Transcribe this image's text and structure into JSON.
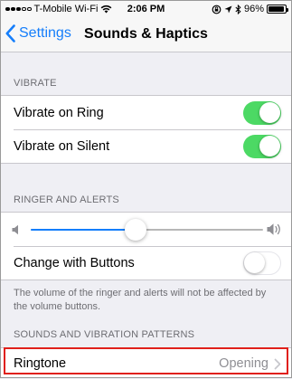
{
  "status_bar": {
    "carrier": "T-Mobile Wi-Fi",
    "time": "2:06 PM",
    "battery": "96%",
    "battery_level": 0.96
  },
  "nav": {
    "back_label": "Settings",
    "title": "Sounds & Haptics"
  },
  "vibrate": {
    "header": "VIBRATE",
    "items": [
      {
        "label": "Vibrate on Ring",
        "on": true
      },
      {
        "label": "Vibrate on Silent",
        "on": true
      }
    ]
  },
  "ringer": {
    "header": "RINGER AND ALERTS",
    "volume_level": 0.45,
    "change_with_buttons_label": "Change with Buttons",
    "change_with_buttons_on": false,
    "footer": "The volume of the ringer and alerts will not be affected by the volume buttons."
  },
  "patterns": {
    "header": "SOUNDS AND VIBRATION PATTERNS",
    "ringtone_label": "Ringtone",
    "ringtone_value": "Opening"
  },
  "colors": {
    "accent": "#157efb",
    "toggle_on": "#4cd964",
    "highlight": "#e0201b"
  }
}
